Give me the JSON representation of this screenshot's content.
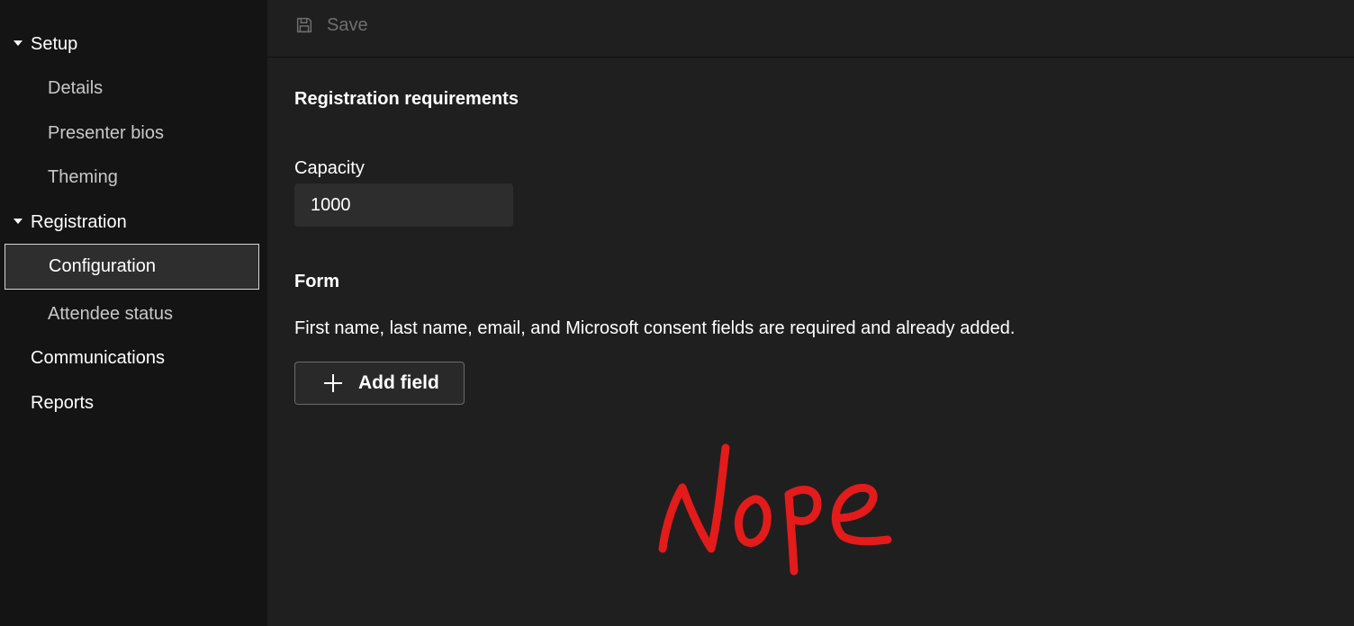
{
  "sidebar": {
    "items": [
      {
        "label": "Setup",
        "level": "top",
        "expanded": true
      },
      {
        "label": "Details",
        "level": "sub"
      },
      {
        "label": "Presenter bios",
        "level": "sub"
      },
      {
        "label": "Theming",
        "level": "sub"
      },
      {
        "label": "Registration",
        "level": "top",
        "expanded": true
      },
      {
        "label": "Configuration",
        "level": "sub",
        "selected": true
      },
      {
        "label": "Attendee status",
        "level": "sub"
      },
      {
        "label": "Communications",
        "level": "top"
      },
      {
        "label": "Reports",
        "level": "top"
      }
    ]
  },
  "toolbar": {
    "save_label": "Save",
    "save_icon": "save-icon"
  },
  "main": {
    "registration_title": "Registration requirements",
    "capacity_label": "Capacity",
    "capacity_value": "1000",
    "form_title": "Form",
    "form_description": "First name, last name, email, and Microsoft consent fields are required and already added.",
    "add_field_label": "Add field",
    "add_field_icon": "plus-icon"
  },
  "annotation": {
    "text": "Nope",
    "color": "#e31b1b"
  },
  "colors": {
    "sidebar_bg": "#141414",
    "main_bg": "#1f1f1f",
    "selected_bg": "#2e2e2e",
    "input_bg": "#2d2d2d",
    "disabled_text": "#6f6f6f"
  }
}
